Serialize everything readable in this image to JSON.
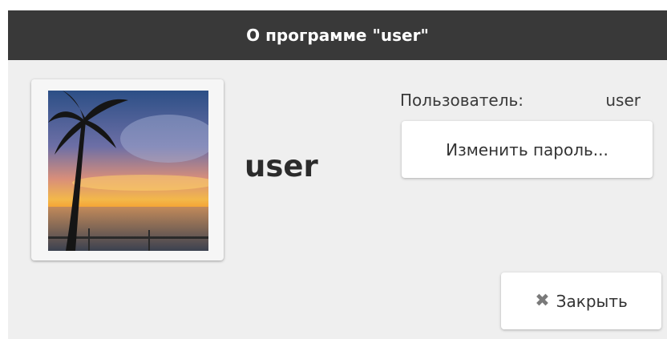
{
  "window": {
    "title": "О программе \"user\""
  },
  "profile": {
    "display_name": "user",
    "user_label": "Пользователь:",
    "user_value": "user",
    "avatar": "palm-tree-sunset-image"
  },
  "buttons": {
    "change_password": "Изменить пароль...",
    "close_icon": "close-icon",
    "close_glyph": "✖",
    "close": "Закрыть"
  }
}
